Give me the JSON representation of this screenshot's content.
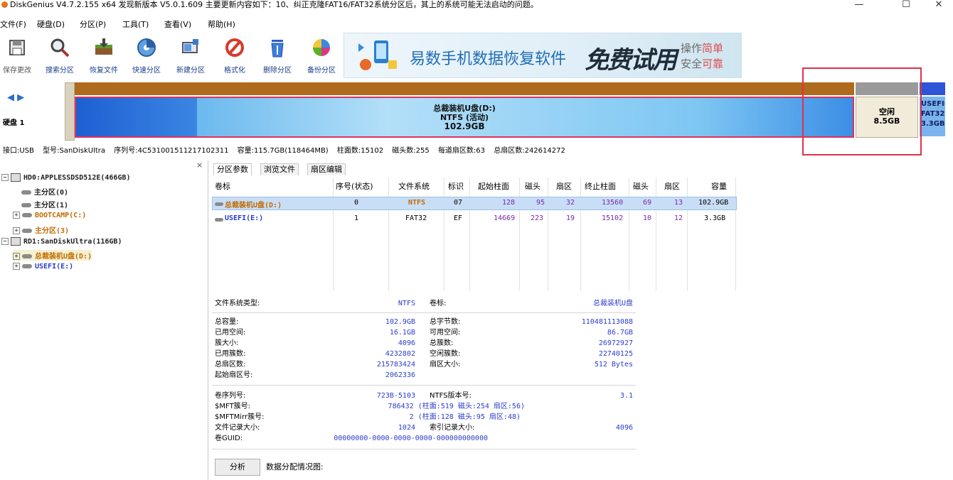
{
  "window": {
    "title": "DiskGenius V4.7.2.155 x64   发现新版本 V5.0.1.609 主要更新内容如下：10、纠正克隆FAT16/FAT32系统分区后，其上的系统可能无法启动的问题。",
    "minimize": "—",
    "maximize": "☐",
    "close": "✕"
  },
  "menu": [
    "文件(F)",
    "硬盘(D)",
    "分区(P)",
    "工具(T)",
    "查看(V)",
    "帮助(H)"
  ],
  "toolbar": [
    {
      "label": "保存更改",
      "icon": "save-changes-icon",
      "color": "#5a5a5a"
    },
    {
      "label": "搜索分区",
      "icon": "search-partition-icon",
      "color": "#3a3a3a"
    },
    {
      "label": "恢复文件",
      "icon": "recover-files-icon",
      "color": "#5b8c2a"
    },
    {
      "label": "快速分区",
      "icon": "quick-partition-icon",
      "color": "#2a6fc8"
    },
    {
      "label": "新建分区",
      "icon": "new-partition-icon",
      "color": "#3a7cc8"
    },
    {
      "label": "格式化",
      "icon": "format-icon",
      "color": "#d83a2a"
    },
    {
      "label": "删除分区",
      "icon": "delete-partition-icon",
      "color": "#2a5fc8"
    },
    {
      "label": "备份分区",
      "icon": "backup-partition-icon",
      "color": "#c83a8a"
    }
  ],
  "banner": {
    "main": "易数手机数据恢复软件",
    "promo": "免费试用",
    "side1": "操作",
    "side1_hl": "简单",
    "side2": "安全",
    "side2_hl": "可靠"
  },
  "disk_nav": {
    "arrows": "◀ ▶",
    "label": "硬盘 1"
  },
  "diskmap": {
    "partD": {
      "name": "总裁装机U盘(D:)",
      "fs": "NTFS (活动)",
      "size": "102.9GB"
    },
    "free": {
      "name": "空闲",
      "size": "8.5GB"
    },
    "partE": {
      "name": "USEFI(",
      "fs": "FAT32",
      "size": "3.3GB"
    }
  },
  "disk_info": [
    "接口:USB",
    "型号:SanDiskUltra",
    "序列号:4C531001511217102311",
    "容量:115.7GB(118464MB)",
    "柱面数:15102",
    "磁头数:255",
    "每道扇区数:63",
    "总扇区数:242614272"
  ],
  "tree": {
    "nodes": [
      {
        "text": "HD0:APPLESSDSD512E(466GB)",
        "level": 0,
        "kind": "disk",
        "color": "normal"
      },
      {
        "text": "主分区(0)",
        "level": 1,
        "kind": "part",
        "color": "normal"
      },
      {
        "text": "主分区(1)",
        "level": 1,
        "kind": "part",
        "color": "normal"
      },
      {
        "text": "BOOTCAMP(C:)",
        "level": 1,
        "kind": "part",
        "color": "orange"
      },
      {
        "text": "主分区(3)",
        "level": 1,
        "kind": "part",
        "color": "orange"
      },
      {
        "text": "RD1:SanDiskUltra(116GB)",
        "level": 0,
        "kind": "disk",
        "color": "normal"
      },
      {
        "text": "总裁装机U盘(D:)",
        "level": 1,
        "kind": "part",
        "color": "orange",
        "selected": true
      },
      {
        "text": "USEFI(E:)",
        "level": 1,
        "kind": "part",
        "color": "blue"
      }
    ]
  },
  "tabs": [
    "分区参数",
    "浏览文件",
    "扇区编辑"
  ],
  "grid": {
    "headers": [
      "卷标",
      "序号(状态)",
      "文件系统",
      "标识",
      "起始柱面",
      "磁头",
      "扇区",
      "终止柱面",
      "磁头",
      "扇区",
      "容量"
    ],
    "rows": [
      [
        "总裁装机U盘(D:)",
        "0",
        "NTFS",
        "07",
        "128",
        "95",
        "32",
        "13560",
        "69",
        "13",
        "102.9GB"
      ],
      [
        "USEFI(E:)",
        "1",
        "FAT32",
        "EF",
        "14669",
        "223",
        "19",
        "15102",
        "10",
        "12",
        "3.3GB"
      ]
    ]
  },
  "details": {
    "fs_type_label": "文件系统类型:",
    "fs_type": "NTFS",
    "vol_label_label": "卷标:",
    "vol_label": "总裁装机U盘",
    "left": [
      {
        "k": "总容量:",
        "v": "102.9GB"
      },
      {
        "k": "已用空间:",
        "v": "16.1GB"
      },
      {
        "k": "簇大小:",
        "v": "4096"
      },
      {
        "k": "已用簇数:",
        "v": "4232802"
      },
      {
        "k": "总扇区数:",
        "v": "215783424"
      },
      {
        "k": "起始扇区号:",
        "v": "2062336"
      }
    ],
    "right": [
      {
        "k": "总字节数:",
        "v": "110481113088"
      },
      {
        "k": "可用空间:",
        "v": "86.7GB"
      },
      {
        "k": "总簇数:",
        "v": "26972927"
      },
      {
        "k": "空闲簇数:",
        "v": "22740125"
      },
      {
        "k": "扇区大小:",
        "v": "512 Bytes"
      }
    ],
    "serial_label": "卷序列号:",
    "serial": "723B-5103",
    "ntfsver_label": "NTFS版本号:",
    "ntfsver": "3.1",
    "mft_label": "$MFT簇号:",
    "mft": "786432 (柱面:519 磁头:254 扇区:56)",
    "mftmirr_label": "$MFTMirr簇号:",
    "mftmirr": "2 (柱面:128 磁头:95 扇区:48)",
    "record_label": "文件记录大小:",
    "record": "1024",
    "index_label": "索引记录大小:",
    "index": "4096",
    "guid_label": "卷GUID:",
    "guid": "00000000-0000-0000-0000-000000000000",
    "analyze": "分析",
    "dist_label": "数据分配情况图:"
  },
  "colors": {
    "accent_red": "#e0315c",
    "part_orange": "#c26b00",
    "part_blue": "#2c3ccc",
    "cell_purple": "#7a2aa8"
  }
}
